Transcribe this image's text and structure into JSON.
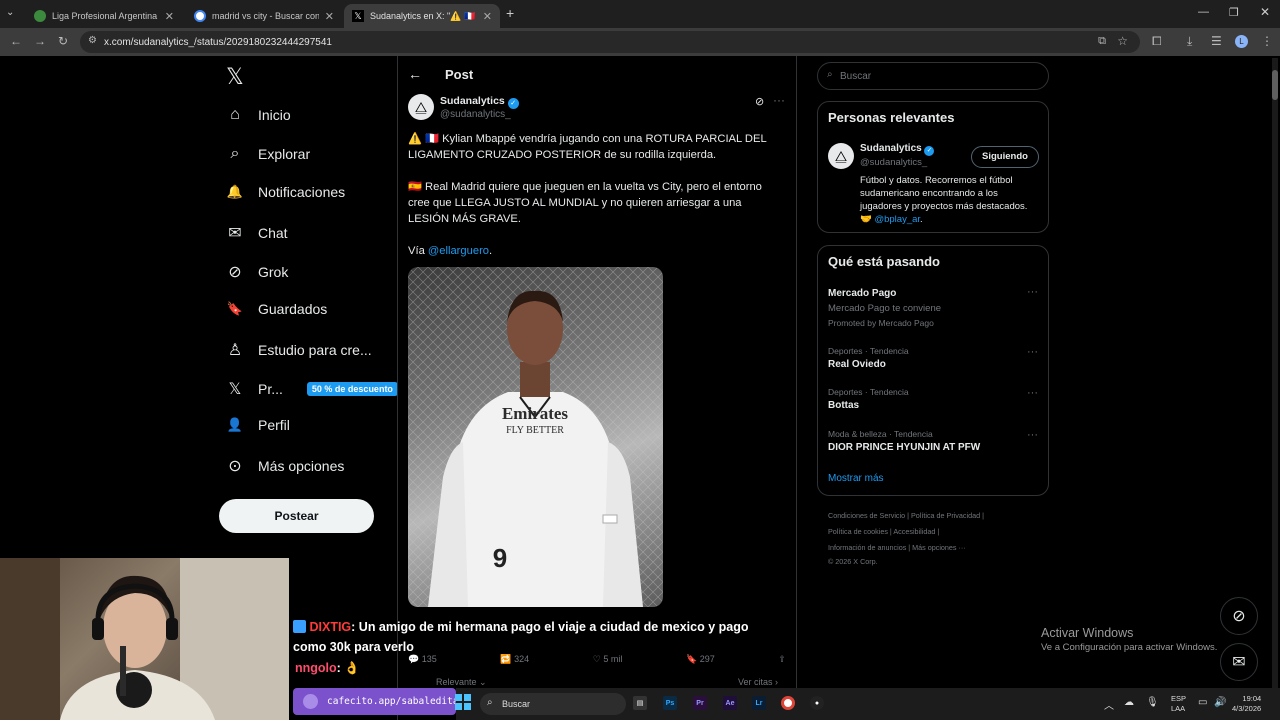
{
  "browser": {
    "tabs": [
      {
        "title": "Liga Profesional Argentina - PC",
        "close": "✕"
      },
      {
        "title": "madrid vs city - Buscar con Goo",
        "close": "✕"
      },
      {
        "title": "Sudanalytics en X: \"⚠️ 🇫🇷 Kylian",
        "close": "✕"
      }
    ],
    "new_tab": "+",
    "url": "x.com/sudanalytics_/status/2029180232444297541"
  },
  "nav": {
    "items": [
      {
        "label": "Inicio",
        "icon": "⌂"
      },
      {
        "label": "Explorar",
        "icon": "⌕"
      },
      {
        "label": "Notificaciones",
        "icon": "🔔"
      },
      {
        "label": "Chat",
        "icon": "✉"
      },
      {
        "label": "Grok",
        "icon": "⊘"
      },
      {
        "label": "Guardados",
        "icon": "🔖"
      },
      {
        "label": "Estudio para cre...",
        "icon": "♙"
      },
      {
        "label": "Pr...",
        "icon": "𝕏"
      },
      {
        "label": "Perfil",
        "icon": "👤"
      },
      {
        "label": "Más opciones",
        "icon": "⊙"
      }
    ],
    "premium_badge": "50 % de descuento",
    "post_button": "Postear"
  },
  "post": {
    "header": "Post",
    "author_name": "Sudanalytics",
    "author_handle": "@sudanalytics_",
    "line1": "⚠️ 🇫🇷 Kylian Mbappé vendría jugando con una ROTURA PARCIAL DEL LIGAMENTO CRUZADO POSTERIOR de su rodilla izquierda.",
    "line2": "🇪🇸 Real Madrid quiere que jueguen en la vuelta vs City, pero el entorno cree que LLEGA JUSTO AL MUNDIAL y no quieren arriesgar a una LESIÓN MÁS GRAVE.",
    "via_prefix": "Vía ",
    "via_link": "@ellarguero",
    "via_suffix": ".",
    "jersey_sponsor": "Emirates",
    "jersey_sponsor2": "FLY BETTER",
    "jersey_number": "9",
    "actions": {
      "replies": "135",
      "reposts": "324",
      "likes": "5 mil",
      "bookmarks": "297"
    },
    "relevant": "Relevante ⌄",
    "quotes": "Ver citas ›"
  },
  "right": {
    "search_placeholder": "Buscar",
    "relevant_title": "Personas relevantes",
    "relevant_person": {
      "name": "Sudanalytics",
      "handle": "@sudanalytics_",
      "follow_label": "Siguiendo",
      "bio": "Fútbol y datos. Recorremos el fútbol sudamericano encontrando a los jugadores y proyectos más destacados. 🤝 ",
      "bio_link": "@bplay_ar",
      "bio_end": "."
    },
    "trending_title": "Qué está pasando",
    "promo": {
      "name": "Mercado Pago",
      "sub": "Mercado Pago te conviene",
      "tag": "Promoted by Mercado Pago"
    },
    "trends": [
      {
        "cat": "Deportes · Tendencia",
        "name": "Real Oviedo"
      },
      {
        "cat": "Deportes · Tendencia",
        "name": "Bottas"
      },
      {
        "cat": "Moda & belleza · Tendencia",
        "name": "DIOR PRINCE HYUNJIN AT PFW"
      }
    ],
    "show_more": "Mostrar más",
    "footer": {
      "l1": "Condiciones de Servicio  |  Política de Privacidad  |",
      "l2": "Política de cookies  |  Accesibilidad  |",
      "l3": "Información de anuncios  |  Más opciones ···",
      "l4": "© 2026 X Corp."
    }
  },
  "overlay": {
    "chat_user1": "DIXTIG",
    "chat_msg1": ": Un amigo de mi hermana pago el viaje a ciudad de mexico y pago como 30k para verlo",
    "chat_user2": "nngolo",
    "chat_msg2": ": 👌",
    "cafecito": "cafecito.app/sabaledita",
    "watermark_title": "Activar Windows",
    "watermark_sub": "Ve a Configuración para activar Windows."
  },
  "taskbar": {
    "search": "Buscar",
    "lang": "ESP",
    "lang2": "LAA",
    "time": "19:04",
    "date": "4/3/2026"
  },
  "colors": {
    "accent": "#1d9bf0",
    "background": "#000000",
    "text": "#e7e9ea",
    "muted": "#71767b"
  }
}
